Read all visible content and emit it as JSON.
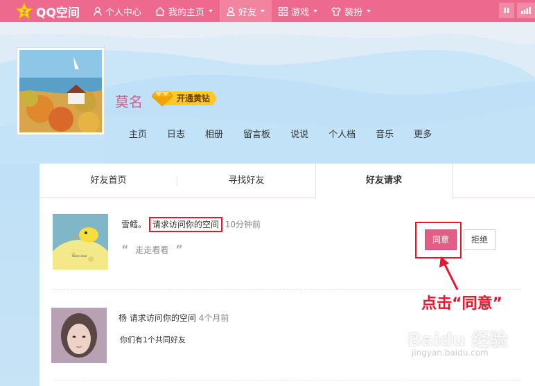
{
  "topnav": {
    "logo": "QQ空间",
    "items": [
      {
        "label": "个人中心",
        "icon": "person-icon",
        "caret": false,
        "active": false
      },
      {
        "label": "我的主页",
        "icon": "home-icon",
        "caret": true,
        "active": false
      },
      {
        "label": "好友",
        "icon": "friend-icon",
        "caret": true,
        "active": true
      },
      {
        "label": "游戏",
        "icon": "grid-icon",
        "caret": true,
        "active": false
      },
      {
        "label": "装扮",
        "icon": "shirt-icon",
        "caret": true,
        "active": false
      }
    ]
  },
  "profile": {
    "name": "莫名",
    "vip_label": "开通黄钻",
    "subnav": [
      "主页",
      "日志",
      "相册",
      "留言板",
      "说说",
      "个人档",
      "音乐",
      "更多"
    ]
  },
  "tabs": [
    "好友首页",
    "寻找好友",
    "好友请求"
  ],
  "requests": [
    {
      "name": "雪鳕。",
      "action": "请求访问你的空间",
      "time": "10分钟前",
      "note": "走走看看",
      "agree": "同意",
      "reject": "拒绝",
      "avatar_text": "Good ideal"
    },
    {
      "name": "杨",
      "action": "请求访问你的空间",
      "time": "4个月前",
      "note": "你们有1个共同好友"
    }
  ],
  "annotation": "点击“同意”",
  "watermark": {
    "brand": "Baidu 经验",
    "url": "jingyan.baidu.com"
  },
  "colors": {
    "nav": "#ed6a8e",
    "accent": "#e25e86",
    "highlight": "#e8162c"
  }
}
